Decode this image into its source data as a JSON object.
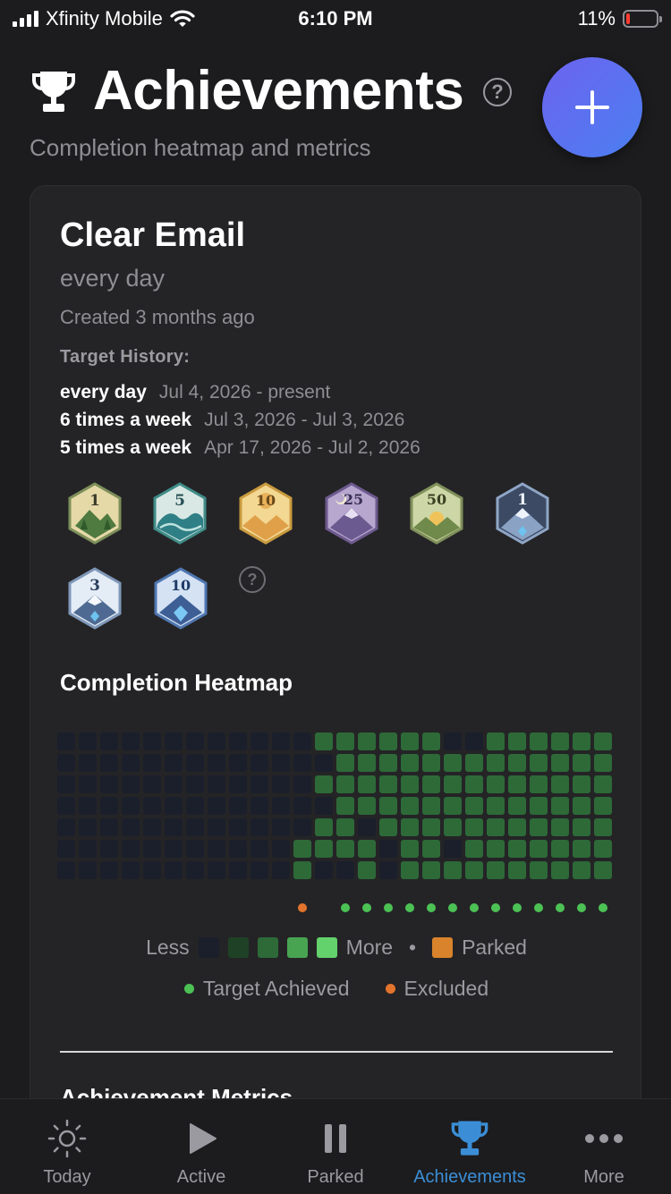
{
  "status_bar": {
    "carrier": "Xfinity Mobile",
    "time": "6:10 PM",
    "battery": "11%"
  },
  "header": {
    "title": "Achievements",
    "subtitle": "Completion heatmap and metrics",
    "help": "?"
  },
  "habit": {
    "name": "Clear Email",
    "frequency": "every day",
    "created": "Created 3 months ago",
    "target_history_label": "Target History:",
    "target_history": [
      {
        "target": "every day",
        "range": "Jul 4, 2026 - present"
      },
      {
        "target": "6 times a week",
        "range": "Jul 3, 2026 - Jul 3, 2026"
      },
      {
        "target": "5 times a week",
        "range": "Apr 17, 2026 - Jul 2, 2026"
      }
    ],
    "badges": [
      {
        "number": "1",
        "theme": "forest"
      },
      {
        "number": "5",
        "theme": "wave"
      },
      {
        "number": "10",
        "theme": "balloon"
      },
      {
        "number": "25",
        "theme": "night-mountain"
      },
      {
        "number": "50",
        "theme": "sunrise"
      },
      {
        "number": "1",
        "theme": "dark-diamond"
      },
      {
        "number": "3",
        "theme": "snow-diamond"
      },
      {
        "number": "10",
        "theme": "blue-diamond"
      }
    ],
    "badge_help": "?"
  },
  "heatmap": {
    "title": "Completion Heatmap",
    "levels": [
      [
        0,
        0,
        0,
        0,
        0,
        0,
        0,
        0,
        0,
        0,
        0,
        0,
        2,
        2,
        2,
        2,
        2,
        2,
        0,
        0,
        2,
        2,
        2,
        2,
        2,
        2,
        2,
        2
      ],
      [
        0,
        0,
        0,
        0,
        0,
        0,
        0,
        0,
        0,
        0,
        0,
        0,
        0,
        2,
        2,
        2,
        2,
        2,
        2,
        2,
        2,
        2,
        2,
        2,
        2,
        2,
        2,
        0
      ],
      [
        0,
        0,
        0,
        0,
        0,
        0,
        0,
        0,
        0,
        0,
        0,
        0,
        2,
        2,
        2,
        2,
        2,
        2,
        2,
        2,
        2,
        2,
        2,
        2,
        2,
        2,
        2,
        0
      ],
      [
        0,
        0,
        0,
        0,
        0,
        0,
        0,
        0,
        0,
        0,
        0,
        0,
        0,
        2,
        2,
        2,
        2,
        2,
        2,
        2,
        2,
        2,
        2,
        2,
        2,
        2,
        2,
        0
      ],
      [
        0,
        0,
        0,
        0,
        0,
        0,
        0,
        0,
        0,
        0,
        0,
        0,
        2,
        2,
        0,
        2,
        2,
        2,
        2,
        2,
        2,
        2,
        2,
        2,
        2,
        2,
        2,
        0
      ],
      [
        0,
        0,
        0,
        0,
        0,
        0,
        0,
        0,
        0,
        0,
        0,
        2,
        2,
        2,
        2,
        0,
        2,
        2,
        0,
        2,
        2,
        2,
        2,
        2,
        2,
        2,
        2,
        0
      ],
      [
        0,
        0,
        0,
        0,
        0,
        0,
        0,
        0,
        0,
        0,
        0,
        2,
        0,
        0,
        2,
        0,
        2,
        2,
        2,
        2,
        2,
        2,
        2,
        2,
        2,
        2,
        2,
        0
      ]
    ],
    "markers": [
      "none",
      "none",
      "none",
      "none",
      "none",
      "none",
      "none",
      "none",
      "none",
      "none",
      "none",
      "excluded",
      "none",
      "achieved",
      "achieved",
      "achieved",
      "achieved",
      "achieved",
      "achieved",
      "achieved",
      "achieved",
      "achieved",
      "achieved",
      "achieved",
      "achieved",
      "achieved",
      "achieved",
      "excluded"
    ],
    "legend": {
      "less": "Less",
      "more": "More",
      "parked": "Parked",
      "achieved": "Target Achieved",
      "excluded": "Excluded"
    },
    "colors": {
      "level0": "#1a1f2b",
      "level1": "#1f4226",
      "level2": "#2d6a38",
      "level3": "#49a452",
      "level4": "#63d16c",
      "parked": "#d9832c",
      "achieved": "#4cc154",
      "excluded": "#e3742d"
    }
  },
  "metrics": {
    "title": "Achievement Metrics"
  },
  "tabs": [
    {
      "label": "Today",
      "icon": "sun-icon",
      "active": false
    },
    {
      "label": "Active",
      "icon": "play-icon",
      "active": false
    },
    {
      "label": "Parked",
      "icon": "pause-icon",
      "active": false
    },
    {
      "label": "Achievements",
      "icon": "trophy-icon",
      "active": true
    },
    {
      "label": "More",
      "icon": "more-icon",
      "active": false
    }
  ]
}
